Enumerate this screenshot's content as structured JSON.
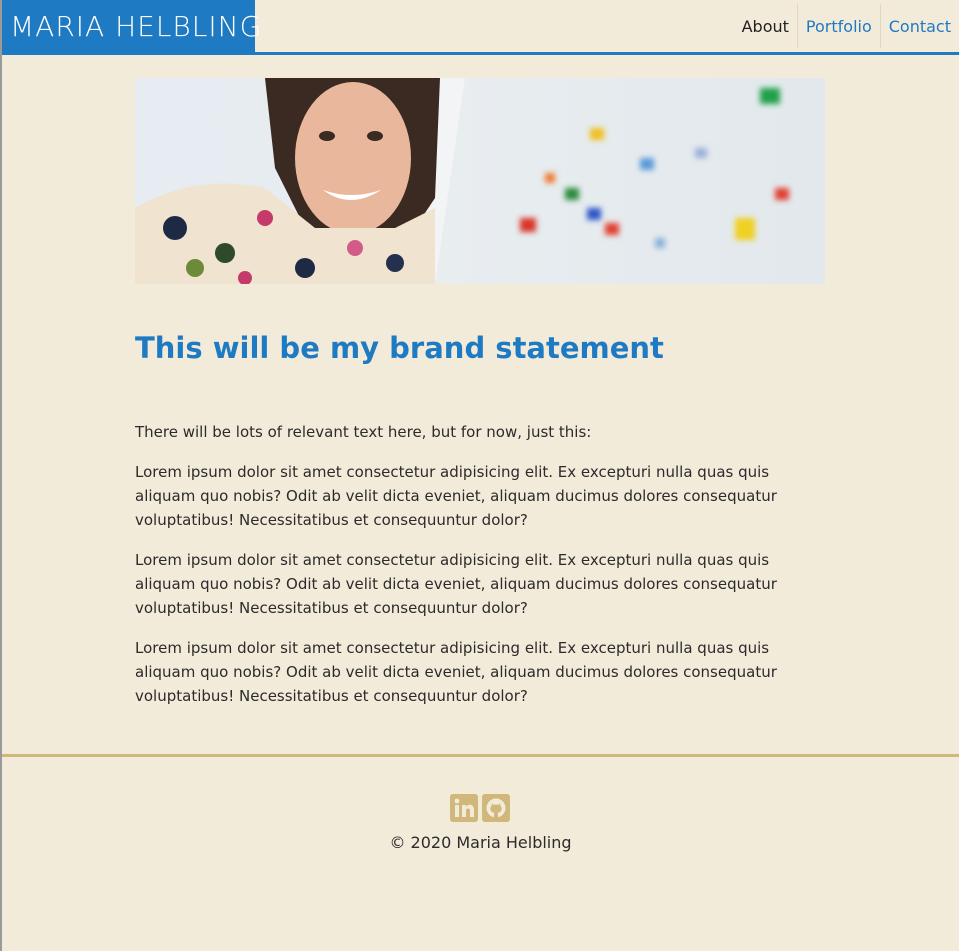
{
  "header": {
    "logo_text": "MARIA HELBLING",
    "nav": [
      {
        "label": "About",
        "active": true
      },
      {
        "label": "Portfolio",
        "active": false
      },
      {
        "label": "Contact",
        "active": false
      }
    ],
    "accent_color": "#1e7ac2"
  },
  "hero": {
    "image_icon": "hero-photo-icon"
  },
  "main": {
    "title": "This will be my brand statement",
    "intro": "There will be lots of relevant text here, but for now, just this:",
    "paragraphs": [
      "Lorem ipsum dolor sit amet consectetur adipisicing elit. Ex excepturi nulla quas quis aliquam quo nobis? Odit ab velit dicta eveniet, aliquam ducimus dolores consequatur voluptatibus! Necessitatibus et consequuntur dolor?",
      "Lorem ipsum dolor sit amet consectetur adipisicing elit. Ex excepturi nulla quas quis aliquam quo nobis? Odit ab velit dicta eveniet, aliquam ducimus dolores consequatur voluptatibus! Necessitatibus et consequuntur dolor?",
      "Lorem ipsum dolor sit amet consectetur adipisicing elit. Ex excepturi nulla quas quis aliquam quo nobis? Odit ab velit dicta eveniet, aliquam ducimus dolores consequatur voluptatibus! Necessitatibus et consequuntur dolor?"
    ]
  },
  "footer": {
    "social": [
      {
        "icon": "linkedin-icon"
      },
      {
        "icon": "github-icon"
      }
    ],
    "copyright": "© 2020 Maria Helbling",
    "accent_color": "#cfb87a"
  },
  "colors": {
    "background": "#f3ebda",
    "brand_blue": "#1e7ac2",
    "footer_gold": "#cfb87a"
  }
}
